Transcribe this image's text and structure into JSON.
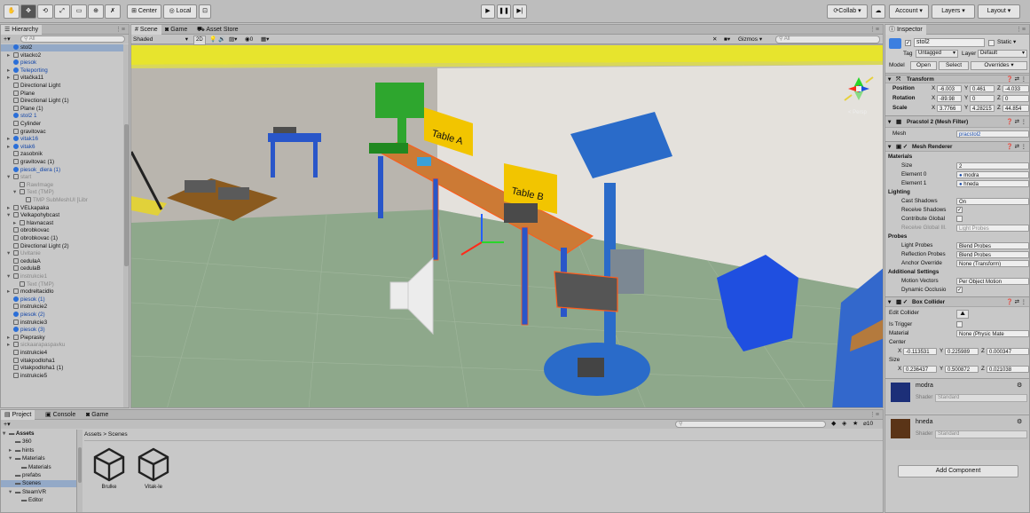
{
  "toolbar": {
    "tools": [
      "hand-icon",
      "move-icon",
      "rotate-icon",
      "scale-icon",
      "rect-icon",
      "transform-icon",
      "custom-tool-icon"
    ],
    "center_label": "Center",
    "local_label": "Local",
    "collab_label": "Collab ▾",
    "account_label": "Account ▾",
    "layers_label": "Layers ▾",
    "layout_label": "Layout ▾"
  },
  "hierarchy": {
    "tab_label": "Hierarchy",
    "add_label": "+▾",
    "search_placeholder": "All",
    "items": [
      {
        "indent": 1,
        "label": "stol2",
        "sel": true,
        "icon": "blue",
        "arrow": ""
      },
      {
        "indent": 1,
        "label": "vitacko2",
        "icon": "box",
        "arrow": "▸"
      },
      {
        "indent": 1,
        "label": "piesok",
        "icon": "blue",
        "arrow": "",
        "color": "blue"
      },
      {
        "indent": 1,
        "label": "Teleporting",
        "icon": "blue",
        "arrow": "▸",
        "color": "blue"
      },
      {
        "indent": 1,
        "label": "vitačka11",
        "icon": "box",
        "arrow": "▸"
      },
      {
        "indent": 1,
        "label": "Directional Light",
        "icon": "box",
        "arrow": ""
      },
      {
        "indent": 1,
        "label": "Plane",
        "icon": "box",
        "arrow": ""
      },
      {
        "indent": 1,
        "label": "Directional Light (1)",
        "icon": "box",
        "arrow": ""
      },
      {
        "indent": 1,
        "label": "Plane (1)",
        "icon": "box",
        "arrow": ""
      },
      {
        "indent": 1,
        "label": "stol2 1",
        "icon": "blue",
        "arrow": "",
        "color": "blue"
      },
      {
        "indent": 1,
        "label": "Cylinder",
        "icon": "box",
        "arrow": ""
      },
      {
        "indent": 1,
        "label": "gravitovac",
        "icon": "box",
        "arrow": ""
      },
      {
        "indent": 1,
        "label": "vitak16",
        "icon": "blue",
        "arrow": "▸",
        "color": "blue"
      },
      {
        "indent": 1,
        "label": "vitak6",
        "icon": "blue",
        "arrow": "▸",
        "color": "blue"
      },
      {
        "indent": 1,
        "label": "zasobnik",
        "icon": "box",
        "arrow": ""
      },
      {
        "indent": 1,
        "label": "gravitovac (1)",
        "icon": "box",
        "arrow": ""
      },
      {
        "indent": 1,
        "label": "piesok_diera (1)",
        "icon": "blue",
        "arrow": "",
        "color": "blue"
      },
      {
        "indent": 1,
        "label": "start",
        "icon": "box",
        "arrow": "▾",
        "color": "dim"
      },
      {
        "indent": 2,
        "label": "RawImage",
        "icon": "box",
        "arrow": "",
        "color": "dim"
      },
      {
        "indent": 2,
        "label": "Text (TMP)",
        "icon": "box",
        "arrow": "▾",
        "color": "dim"
      },
      {
        "indent": 3,
        "label": "TMP SubMeshUI [Libr",
        "icon": "box",
        "arrow": "",
        "color": "dim"
      },
      {
        "indent": 1,
        "label": "VELkapaka",
        "icon": "box",
        "arrow": "▸"
      },
      {
        "indent": 1,
        "label": "Velkapohybcast",
        "icon": "box",
        "arrow": "▾"
      },
      {
        "indent": 2,
        "label": "hlavnacast",
        "icon": "box",
        "arrow": "▸"
      },
      {
        "indent": 1,
        "label": "obrobkovac",
        "icon": "box",
        "arrow": ""
      },
      {
        "indent": 1,
        "label": "obrobkovac (1)",
        "icon": "box",
        "arrow": ""
      },
      {
        "indent": 1,
        "label": "Directional Light (2)",
        "icon": "box",
        "arrow": ""
      },
      {
        "indent": 1,
        "label": "Uvitanie",
        "icon": "box",
        "arrow": "▾",
        "color": "dim"
      },
      {
        "indent": 1,
        "label": "cedulaA",
        "icon": "box",
        "arrow": ""
      },
      {
        "indent": 1,
        "label": "cedulaB",
        "icon": "box",
        "arrow": ""
      },
      {
        "indent": 1,
        "label": "instrukcie1",
        "icon": "box",
        "arrow": "▾",
        "color": "dim"
      },
      {
        "indent": 2,
        "label": "Text (TMP)",
        "icon": "box",
        "arrow": "",
        "color": "dim"
      },
      {
        "indent": 1,
        "label": "modreltacidlo",
        "icon": "box",
        "arrow": "▸"
      },
      {
        "indent": 1,
        "label": "piesok (1)",
        "icon": "blue",
        "arrow": "",
        "color": "blue"
      },
      {
        "indent": 1,
        "label": "instrukcie2",
        "icon": "box",
        "arrow": ""
      },
      {
        "indent": 1,
        "label": "piesok (2)",
        "icon": "blue",
        "arrow": "",
        "color": "blue"
      },
      {
        "indent": 1,
        "label": "instrukcie3",
        "icon": "box",
        "arrow": ""
      },
      {
        "indent": 1,
        "label": "piesok (3)",
        "icon": "blue",
        "arrow": "",
        "color": "blue"
      },
      {
        "indent": 1,
        "label": "Pieprasky",
        "icon": "box",
        "arrow": "▸"
      },
      {
        "indent": 1,
        "label": "sickaarapaspavku",
        "icon": "box",
        "arrow": "▸",
        "color": "dim"
      },
      {
        "indent": 1,
        "label": "instrukcie4",
        "icon": "box",
        "arrow": ""
      },
      {
        "indent": 1,
        "label": "vitakpodloha1",
        "icon": "box",
        "arrow": ""
      },
      {
        "indent": 1,
        "label": "vitakpodloha1 (1)",
        "icon": "box",
        "arrow": ""
      },
      {
        "indent": 1,
        "label": "instrukcie5",
        "icon": "box",
        "arrow": ""
      }
    ]
  },
  "scene": {
    "tabs": [
      "Scene",
      "Game",
      "Asset Store"
    ],
    "shading": "Shaded",
    "mode_2d": "2D",
    "gizmos_label": "Gizmos ▾",
    "search_placeholder": "All",
    "persp_label": "< Persp",
    "sign_a": "Table A",
    "sign_b": "Table B"
  },
  "project": {
    "tabs": [
      "Project",
      "Console",
      "Game"
    ],
    "add_label": "+▾",
    "search_placeholder": "",
    "count_label": "10",
    "tree": [
      {
        "indent": 0,
        "label": "Assets",
        "arrow": "▾",
        "bold": true
      },
      {
        "indent": 1,
        "label": "360",
        "arrow": ""
      },
      {
        "indent": 1,
        "label": "hints",
        "arrow": "▸"
      },
      {
        "indent": 1,
        "label": "Materials",
        "arrow": "▾"
      },
      {
        "indent": 2,
        "label": "Materials",
        "arrow": ""
      },
      {
        "indent": 1,
        "label": "prefabs",
        "arrow": ""
      },
      {
        "indent": 1,
        "label": "Scenes",
        "arrow": "",
        "sel": true
      },
      {
        "indent": 1,
        "label": "SteamVR",
        "arrow": "▾"
      },
      {
        "indent": 2,
        "label": "Editor",
        "arrow": ""
      }
    ],
    "breadcrumb": "Assets > Scenes",
    "assets": [
      "Brulke",
      "Vitak-le"
    ]
  },
  "inspector": {
    "tab_label": "Inspector",
    "object_name": "stol2",
    "static_label": "Static ▾",
    "tag_label": "Tag",
    "tag_value": "Untagged",
    "layer_label": "Layer",
    "layer_value": "Default",
    "model_label": "Model",
    "open_label": "Open",
    "select_label": "Select",
    "overrides_label": "Overrides ▾",
    "transform": {
      "title": "Transform",
      "position": {
        "label": "Position",
        "x": "-6.003",
        "y": "0.461",
        "z": "-4.033"
      },
      "rotation": {
        "label": "Rotation",
        "x": "-89.98",
        "y": "0",
        "z": "0"
      },
      "scale": {
        "label": "Scale",
        "x": "3.7766",
        "y": "4.28215",
        "z": "44.854"
      }
    },
    "mesh_filter": {
      "title": "Pracstol 2 (Mesh Filter)",
      "mesh_label": "Mesh",
      "mesh_value": "pracstol2"
    },
    "mesh_renderer": {
      "title": "Mesh Renderer",
      "materials_label": "Materials",
      "size_label": "Size",
      "size_value": "2",
      "element0_label": "Element 0",
      "element0_value": "modra",
      "element1_label": "Element 1",
      "element1_value": "hneda",
      "lighting_label": "Lighting",
      "cast_label": "Cast Shadows",
      "cast_value": "On",
      "receive_label": "Receive Shadows",
      "contribute_label": "Contribute Global",
      "receive_gi_label": "Receive Global Ill.",
      "receive_gi_value": "Light Probes",
      "probes_label": "Probes",
      "light_probes_label": "Light Probes",
      "light_probes_value": "Blend Probes",
      "reflection_label": "Reflection Probes",
      "reflection_value": "Blend Probes",
      "anchor_label": "Anchor Override",
      "anchor_value": "None (Transform)",
      "additional_label": "Additional Settings",
      "motion_label": "Motion Vectors",
      "motion_value": "Per Object Motion",
      "dynamic_label": "Dynamic Occlusio"
    },
    "box_collider": {
      "title": "Box Collider",
      "edit_label": "Edit Collider",
      "trigger_label": "Is Trigger",
      "material_label": "Material",
      "material_value": "None (Physic Mate",
      "center_label": "Center",
      "center": {
        "x": "-0.113531",
        "y": "0.225989",
        "z": "0.000347"
      },
      "size_label": "Size",
      "size": {
        "x": "0.236437",
        "y": "0.500872",
        "z": "0.021038"
      }
    },
    "materials": [
      {
        "name": "modra",
        "shader_label": "Shader",
        "shader_value": "Standard",
        "color": "#1c2f78"
      },
      {
        "name": "hneda",
        "shader_label": "Shader",
        "shader_value": "Standard",
        "color": "#5a3417"
      }
    ],
    "add_component": "Add Component"
  }
}
